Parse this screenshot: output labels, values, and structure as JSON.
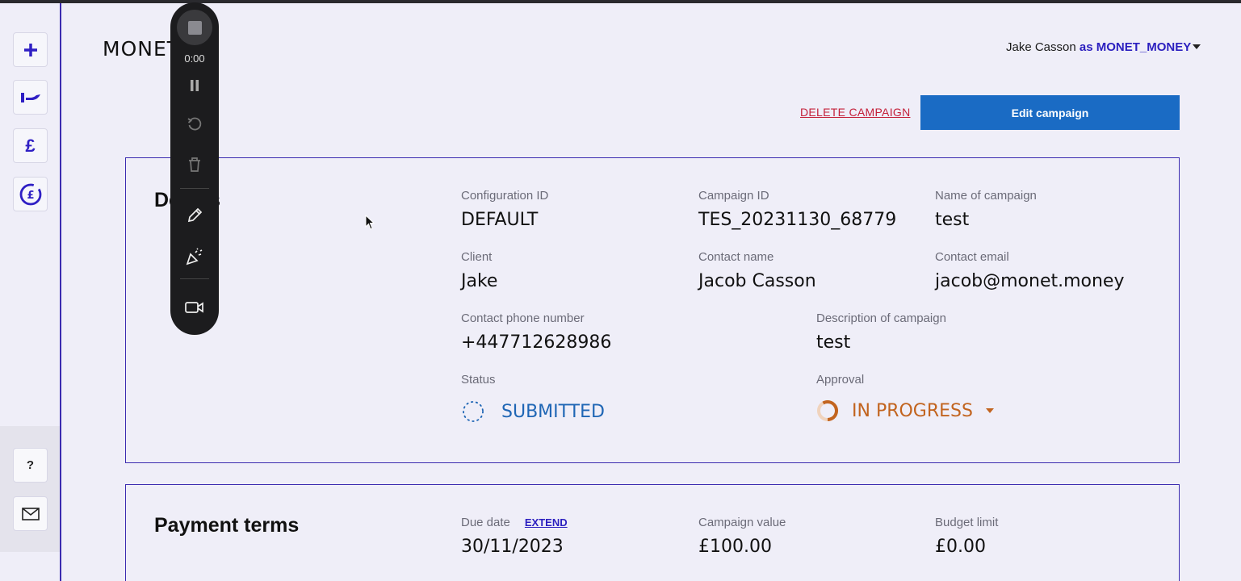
{
  "recorder": {
    "timer": "0:00",
    "icons": [
      "stop-icon",
      "pause-icon",
      "restart-icon",
      "trash-icon",
      "pen-icon",
      "effects-icon",
      "camera-icon"
    ]
  },
  "sidebar": {
    "items": [
      {
        "icon": "plus-icon"
      },
      {
        "icon": "hand-coin-icon"
      },
      {
        "icon": "pound-icon"
      },
      {
        "icon": "pound-circle-icon"
      }
    ],
    "help_label": "?",
    "bottom_icons": [
      "help-icon",
      "mail-icon"
    ]
  },
  "header": {
    "logo": "MONET",
    "user_name": "Jake Casson",
    "user_as": "as MONET_MONEY"
  },
  "actions": {
    "delete_label": "DELETE CAMPAIGN",
    "edit_label": "Edit campaign"
  },
  "details": {
    "title": "Details",
    "configuration_id": {
      "label": "Configuration ID",
      "value": "DEFAULT"
    },
    "campaign_id": {
      "label": "Campaign ID",
      "value": "TES_20231130_68779"
    },
    "campaign_name": {
      "label": "Name of campaign",
      "value": "test"
    },
    "client": {
      "label": "Client",
      "value": "Jake"
    },
    "contact_name": {
      "label": "Contact name",
      "value": "Jacob Casson"
    },
    "contact_email": {
      "label": "Contact email",
      "value": "jacob@monet.money"
    },
    "contact_phone": {
      "label": "Contact phone number",
      "value": "+447712628986"
    },
    "description": {
      "label": "Description of campaign",
      "value": "test"
    },
    "status": {
      "label": "Status",
      "value": "SUBMITTED"
    },
    "approval": {
      "label": "Approval",
      "value": "IN PROGRESS"
    }
  },
  "payment": {
    "title": "Payment terms",
    "due_date": {
      "label": "Due date",
      "value": "30/11/2023",
      "extend_label": "EXTEND"
    },
    "campaign_value": {
      "label": "Campaign value",
      "value": "£100.00"
    },
    "budget_limit": {
      "label": "Budget limit",
      "value": "£0.00"
    }
  },
  "colors": {
    "accent": "#2b1fbf",
    "primary_button": "#1a6bc4",
    "danger": "#c4213a",
    "status_submitted": "#1f66b5",
    "status_in_progress": "#c2641f"
  }
}
